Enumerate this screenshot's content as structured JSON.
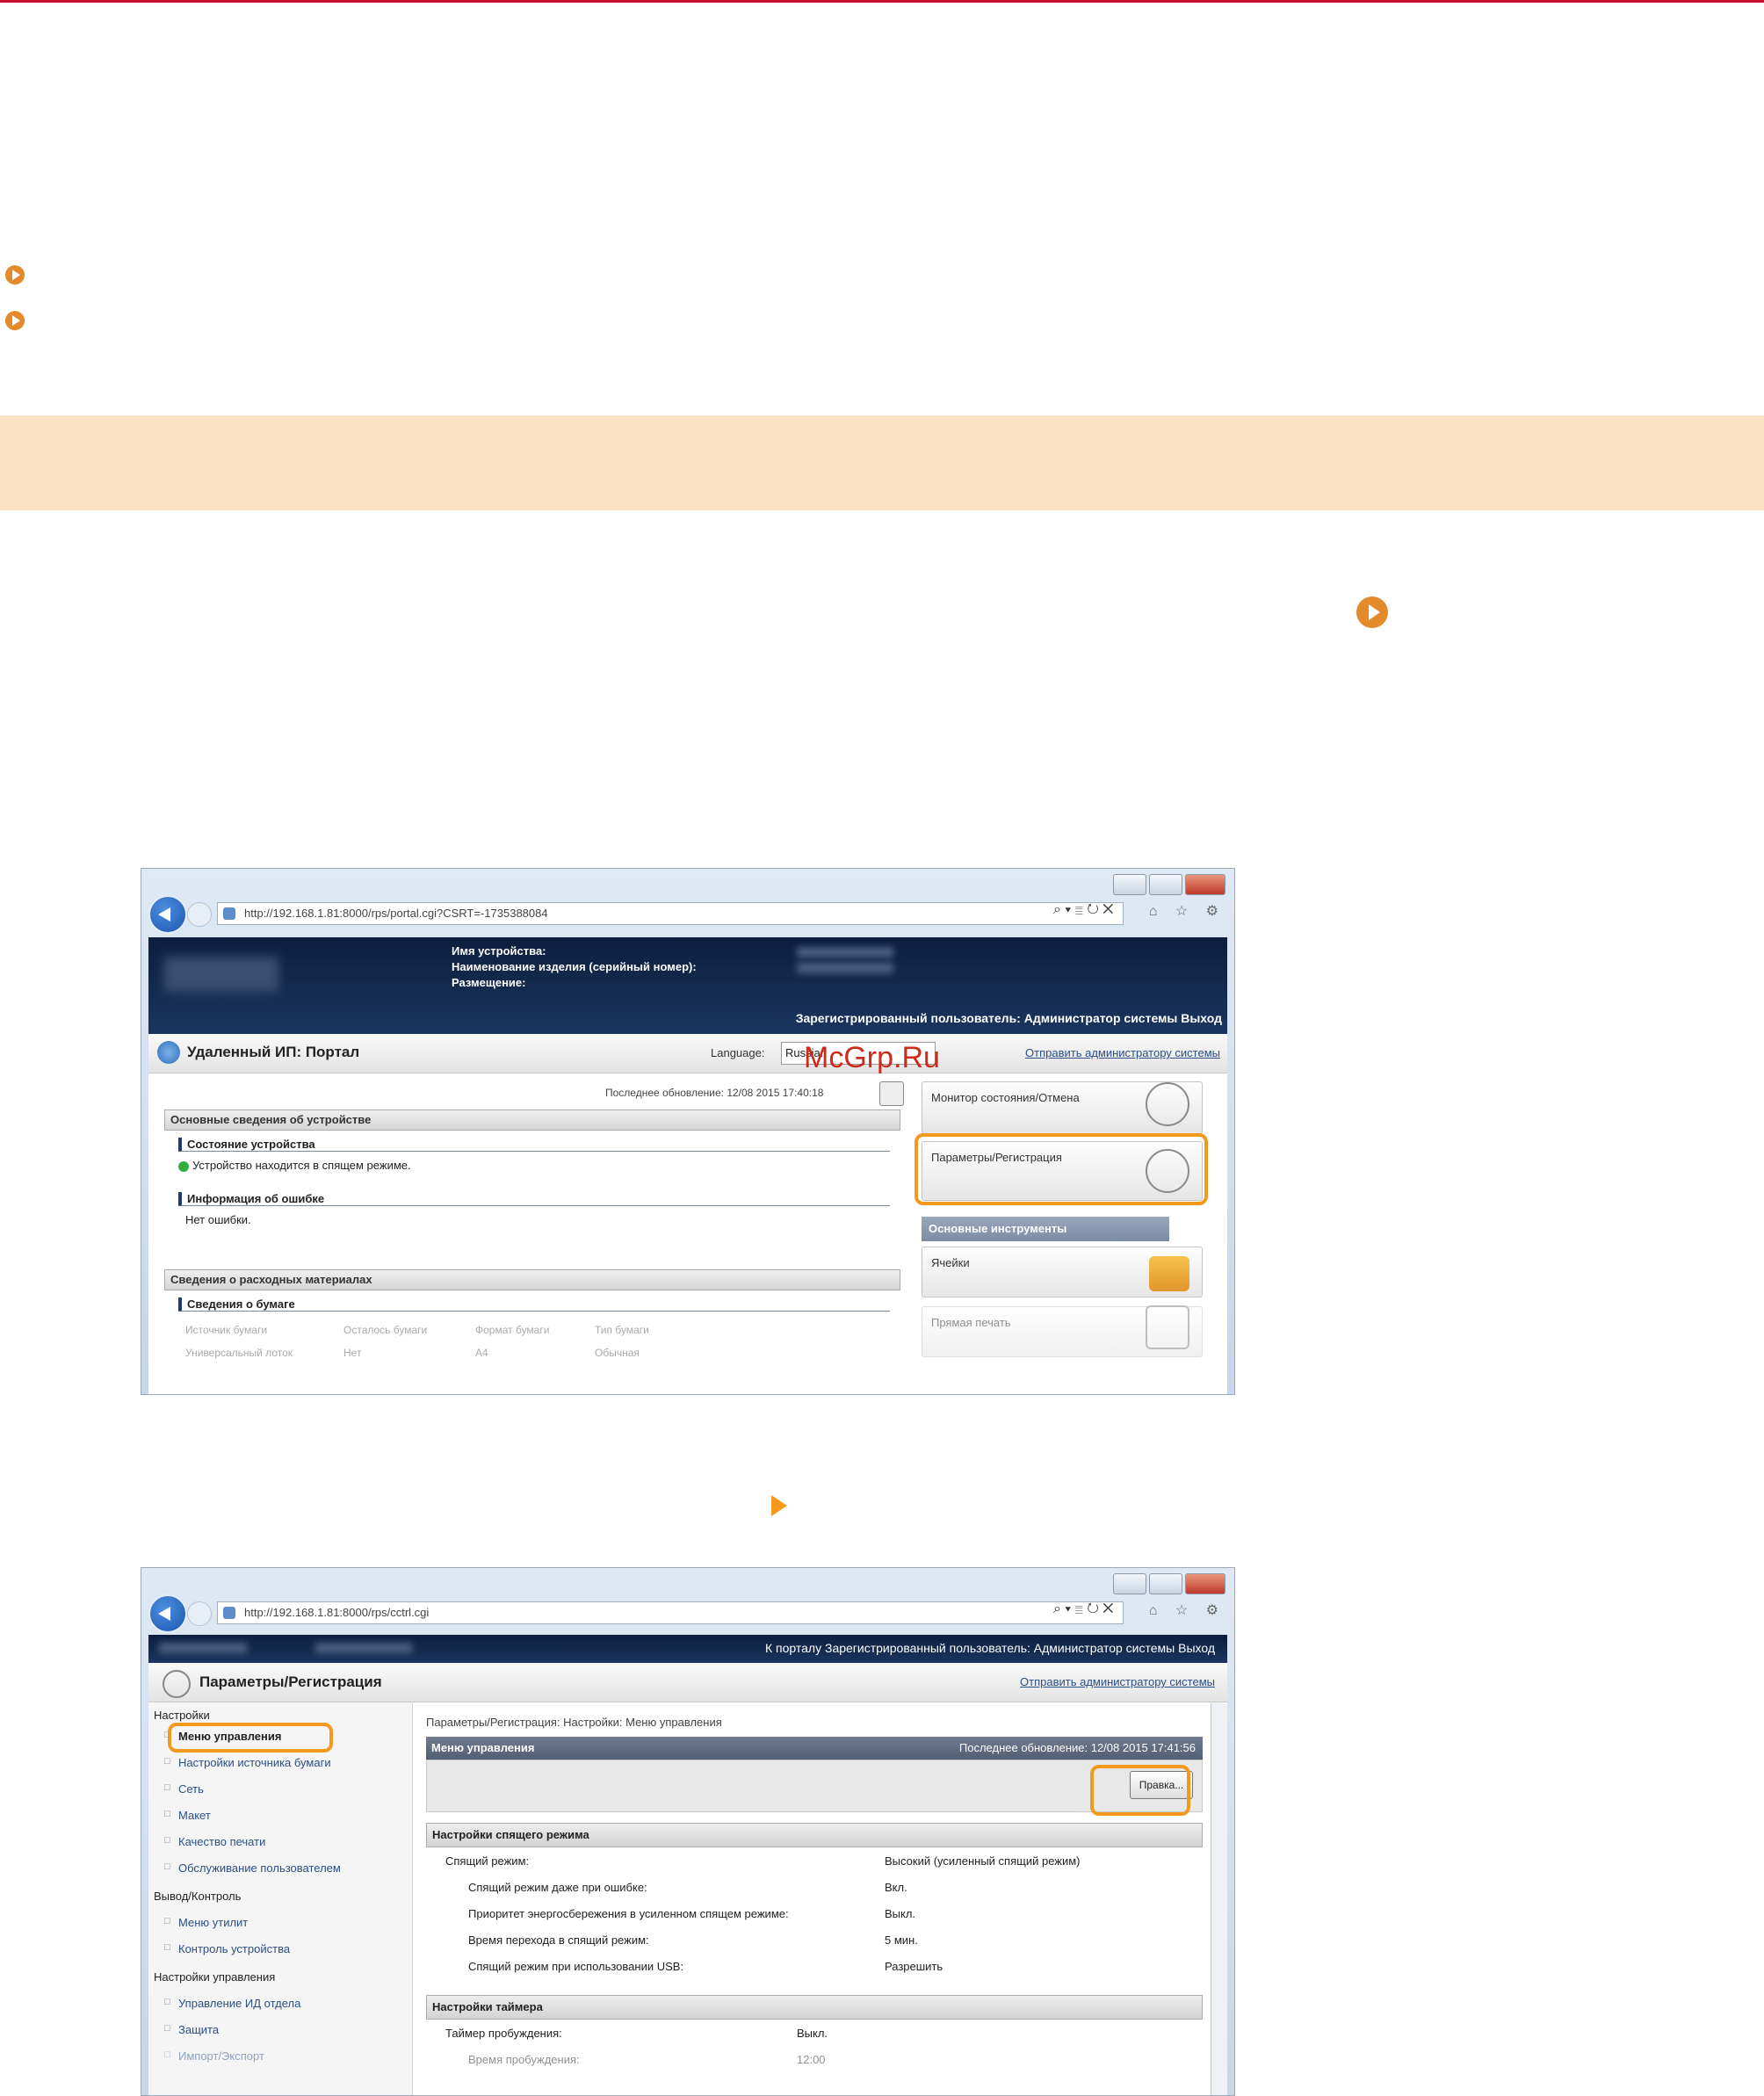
{
  "window1": {
    "url": "http://192.168.1.81:8000/rps/portal.cgi?CSRT=-1735388084",
    "url_tools": "⌕ ▾ ≣ ↻ ✕",
    "nav_icons": "⌂ ☆ ⚙",
    "device_name_label": "Имя устройства:",
    "product_name_label": "Наименование изделия (серийный номер):",
    "location_label": "Размещение:",
    "logged_in_user": "Зарегистрированный пользователь: Администратор системы Выход",
    "portal_title": "Удаленный ИП: Портал",
    "language_label": "Language:",
    "language_value": "Russian",
    "send_to_admin": "Отправить администратору системы",
    "watermark": "McGrp.Ru",
    "last_updated": "Последнее обновление: 12/08 2015 17:40:18",
    "device_basic_info": "Основные сведения об устройстве",
    "device_status_title": "Состояние устройства",
    "device_status_text": "Устройство находится в спящем режиме.",
    "error_info_title": "Информация об ошибке",
    "error_info_text": "Нет ошибки.",
    "consumables_title": "Сведения о расходных материалах",
    "paper_info_title": "Сведения о бумаге",
    "paper_table_headers": [
      "Источник бумаги",
      "Осталось бумаги",
      "Формат бумаги",
      "Тип бумаги"
    ],
    "paper_table_row": [
      "Универсальный лоток",
      "Нет",
      "A4",
      "Обычная"
    ],
    "status_monitor_button": "Монитор состояния/Отмена",
    "settings_button": "Параметры/Регистрация",
    "basic_tools_tab": "Основные инструменты",
    "mailbox_button": "Ячейки",
    "direct_print_button": "Прямая печать"
  },
  "window2": {
    "url": "http://192.168.1.81:8000/rps/cctrl.cgi",
    "url_tools": "⌕ ▾ ≣ ↻ ✕",
    "nav_icons": "⌂ ☆ ⚙",
    "header_right": "К порталу   Зарегистрированный пользователь: Администратор системы Выход",
    "title": "Параметры/Регистрация",
    "send_to_admin": "Отправить администратору системы",
    "nav": {
      "settings_section": "Настройки",
      "control_menu": "Меню управления",
      "paper_source": "Настройки источника бумаги",
      "network": "Сеть",
      "layout": "Макет",
      "print_quality": "Качество печати",
      "user_maintenance": "Обслуживание пользователем",
      "output_section": "Вывод/Контроль",
      "utility_menu": "Меню утилит",
      "device_control": "Контроль устройства",
      "mgmt_section": "Настройки управления",
      "dept_id_mgmt": "Управление ИД отдела",
      "security": "Защита",
      "import_export": "Импорт/Экспорт"
    },
    "breadcrumb": "Параметры/Регистрация: Настройки: Меню управления",
    "control_menu_header": "Меню управления",
    "last_updated": "Последнее обновление: 12/08 2015 17:41:56",
    "edit_button": "Правка...",
    "sleep_settings_header": "Настройки спящего режима",
    "sleep_rows": [
      {
        "label": "Спящий режим:",
        "value": "Высокий (усиленный спящий режим)"
      },
      {
        "label": "Спящий режим даже при ошибке:",
        "value": "Вкл."
      },
      {
        "label": "Приоритет энергосбережения в усиленном спящем режиме:",
        "value": "Выкл."
      },
      {
        "label": "Время перехода в спящий режим:",
        "value": "5 мин."
      },
      {
        "label": "Спящий режим при использовании USB:",
        "value": "Разрешить"
      }
    ],
    "timer_header": "Настройки таймера",
    "timer_rows": [
      {
        "label": "Таймер пробуждения:",
        "value": "Выкл."
      },
      {
        "label": "Время пробуждения:",
        "value": "12:00"
      }
    ]
  }
}
